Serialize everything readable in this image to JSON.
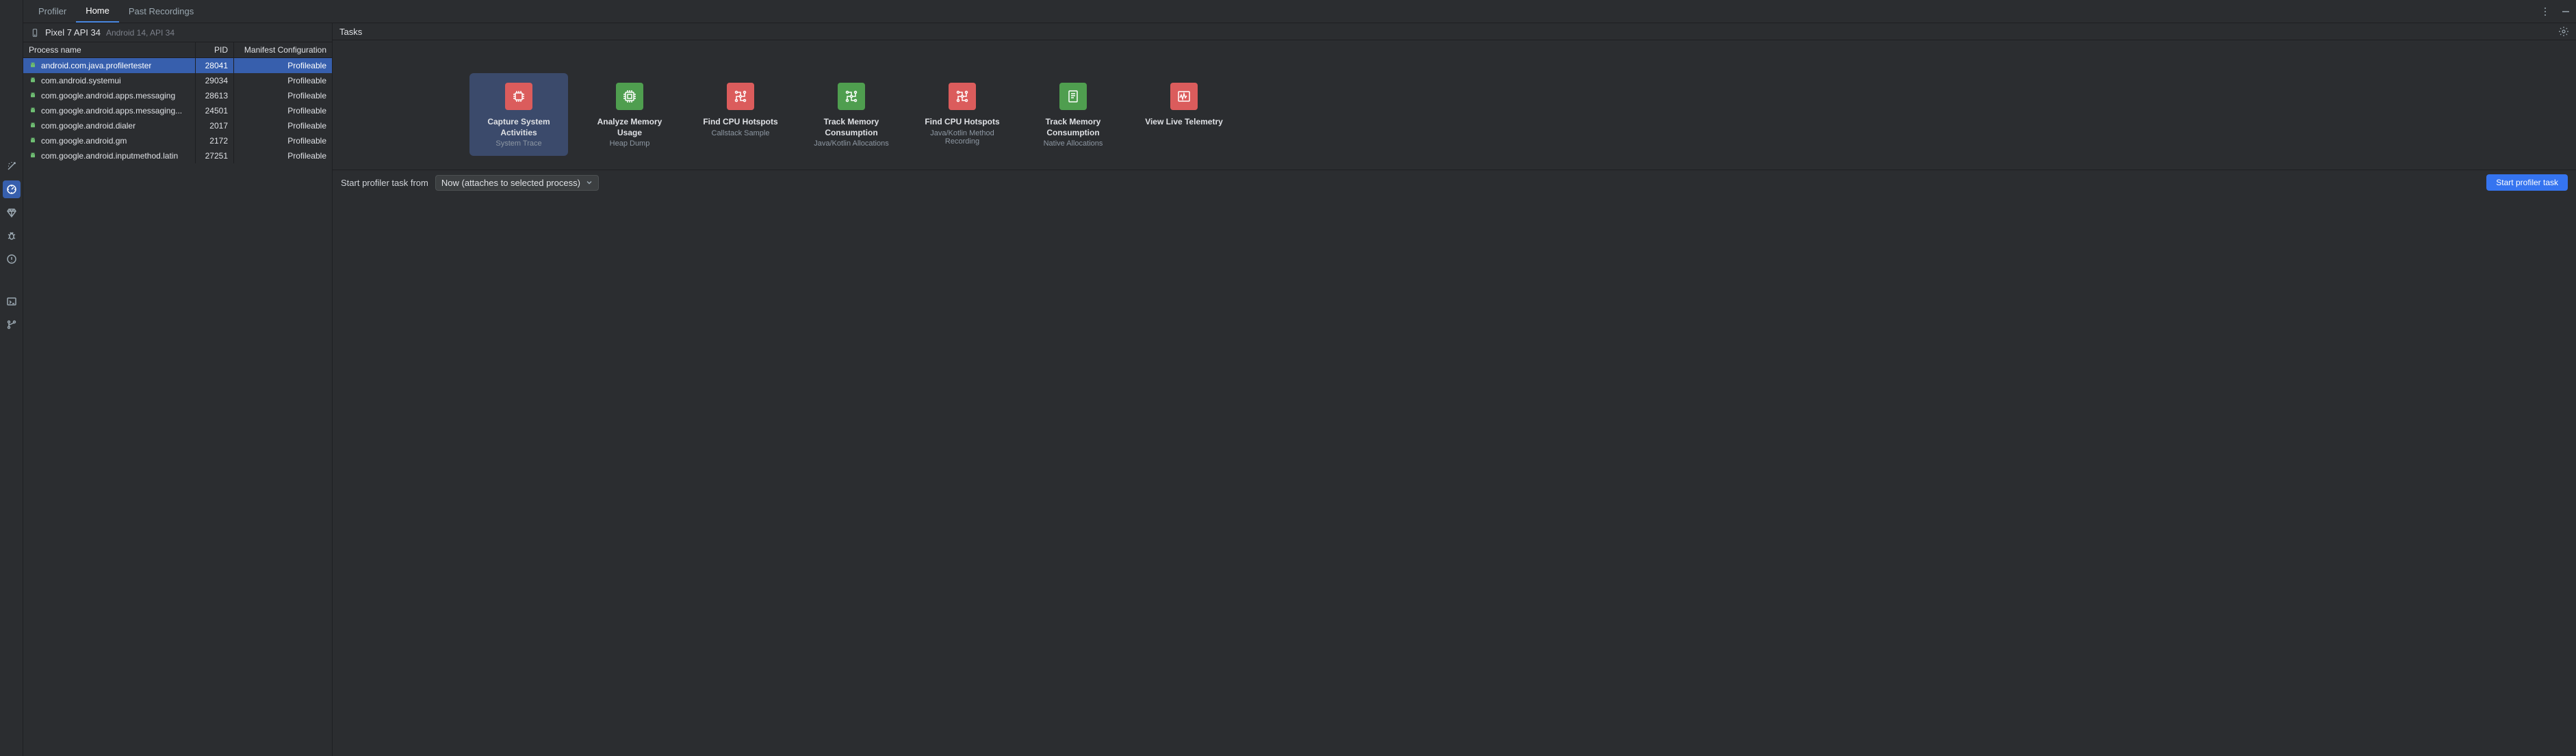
{
  "tabs": {
    "profiler": "Profiler",
    "home": "Home",
    "past": "Past Recordings"
  },
  "device": {
    "name": "Pixel 7 API 34",
    "sub": "Android 14, API 34"
  },
  "table": {
    "headers": {
      "process": "Process name",
      "pid": "PID",
      "manifest": "Manifest Configuration"
    },
    "rows": [
      {
        "name": "android.com.java.profilertester",
        "pid": "28041",
        "manifest": "Profileable",
        "selected": true
      },
      {
        "name": "com.android.systemui",
        "pid": "29034",
        "manifest": "Profileable",
        "selected": false
      },
      {
        "name": "com.google.android.apps.messaging",
        "pid": "28613",
        "manifest": "Profileable",
        "selected": false
      },
      {
        "name": "com.google.android.apps.messaging...",
        "pid": "24501",
        "manifest": "Profileable",
        "selected": false
      },
      {
        "name": "com.google.android.dialer",
        "pid": "2017",
        "manifest": "Profileable",
        "selected": false
      },
      {
        "name": "com.google.android.gm",
        "pid": "2172",
        "manifest": "Profileable",
        "selected": false
      },
      {
        "name": "com.google.android.inputmethod.latin",
        "pid": "27251",
        "manifest": "Profileable",
        "selected": false
      }
    ]
  },
  "tasks": {
    "header": "Tasks",
    "cards": [
      {
        "title": "Capture System Activities",
        "sub": "System Trace",
        "color": "red",
        "icon": "cpu",
        "selected": true
      },
      {
        "title": "Analyze Memory Usage",
        "sub": "Heap Dump",
        "color": "green",
        "icon": "chip",
        "selected": false
      },
      {
        "title": "Find CPU Hotspots",
        "sub": "Callstack Sample",
        "color": "red",
        "icon": "circuit",
        "selected": false
      },
      {
        "title": "Track Memory Consumption",
        "sub": "Java/Kotlin Allocations",
        "color": "green",
        "icon": "circuit",
        "selected": false
      },
      {
        "title": "Find CPU Hotspots",
        "sub": "Java/Kotlin Method Recording",
        "color": "red",
        "icon": "circuit",
        "selected": false
      },
      {
        "title": "Track Memory Consumption",
        "sub": "Native Allocations",
        "color": "green",
        "icon": "doc",
        "selected": false
      },
      {
        "title": "View Live Telemetry",
        "sub": "",
        "color": "red",
        "icon": "wave",
        "selected": false
      }
    ]
  },
  "footer": {
    "label": "Start profiler task from",
    "selected": "Now (attaches to selected process)",
    "button": "Start profiler task"
  }
}
